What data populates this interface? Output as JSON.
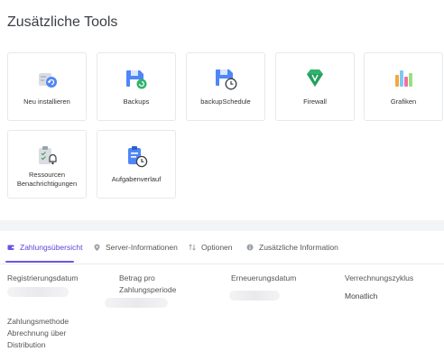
{
  "page": {
    "title": "Zusätzliche Tools"
  },
  "tools": [
    {
      "label": "Neu installieren",
      "icon": "reinstall-icon"
    },
    {
      "label": "Backups",
      "icon": "backup-icon"
    },
    {
      "label": "backupSchedule",
      "icon": "backup-schedule-icon"
    },
    {
      "label": "Firewall",
      "icon": "firewall-icon"
    },
    {
      "label": "Grafiken",
      "icon": "graphs-icon"
    },
    {
      "label": "Ressourcen Benachrichtigungen",
      "icon": "resource-notification-icon"
    },
    {
      "label": "Aufgabenverlauf",
      "icon": "task-history-icon"
    }
  ],
  "tabs": [
    {
      "label": "Zahlungsübersicht",
      "icon": "wallet-icon",
      "active": true
    },
    {
      "label": "Server-Informationen",
      "icon": "location-pin-icon",
      "active": false
    },
    {
      "label": "Optionen",
      "icon": "sort-arrows-icon",
      "active": false
    },
    {
      "label": "Zusätzliche Information",
      "icon": "info-icon",
      "active": false
    }
  ],
  "billing": {
    "registration_date_label": "Registrierungsdatum",
    "amount_label": "Betrag pro Zahlungsperiode",
    "renewal_date_label": "Erneuerungsdatum",
    "billing_cycle_label": "Verrechnungszyklus",
    "billing_cycle_value": "Monatlich",
    "payment_method_label": "Zahlungsmethode",
    "payment_method_value": "Abrechnung über Distribution"
  },
  "colors": {
    "accent": "#6a55e0",
    "icon_blue": "#4f86f7",
    "icon_green": "#2fb36b"
  }
}
